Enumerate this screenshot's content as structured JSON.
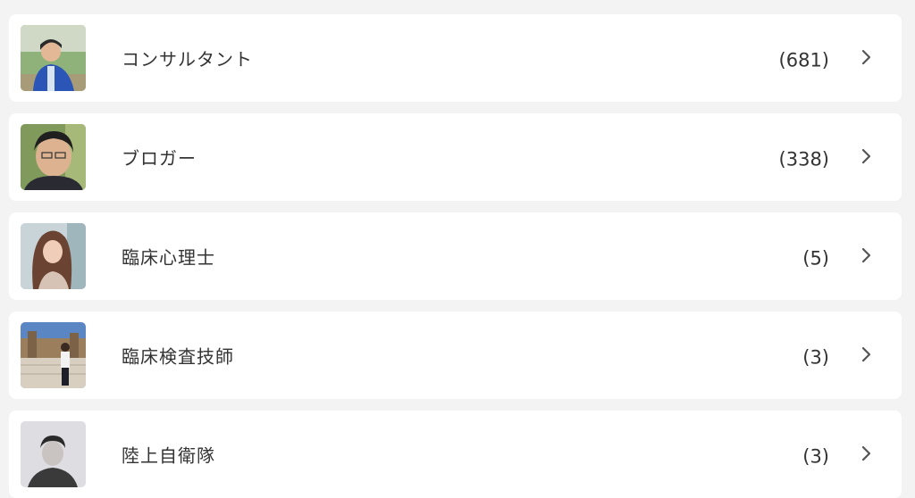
{
  "colors": {
    "page_bg": "#f3f3f3",
    "card_bg": "#ffffff",
    "text": "#333333",
    "chevron": "#555555"
  },
  "professions": [
    {
      "label": "コンサルタント",
      "count": "(681)",
      "avatar": "person-blue-jacket-outdoors"
    },
    {
      "label": "ブロガー",
      "count": "(338)",
      "avatar": "man-with-glasses-closeup"
    },
    {
      "label": "臨床心理士",
      "count": "(5)",
      "avatar": "woman-long-hair"
    },
    {
      "label": "臨床検査技師",
      "count": "(3)",
      "avatar": "person-at-monument"
    },
    {
      "label": "陸上自衛隊",
      "count": "(3)",
      "avatar": "person-grayscale"
    }
  ]
}
